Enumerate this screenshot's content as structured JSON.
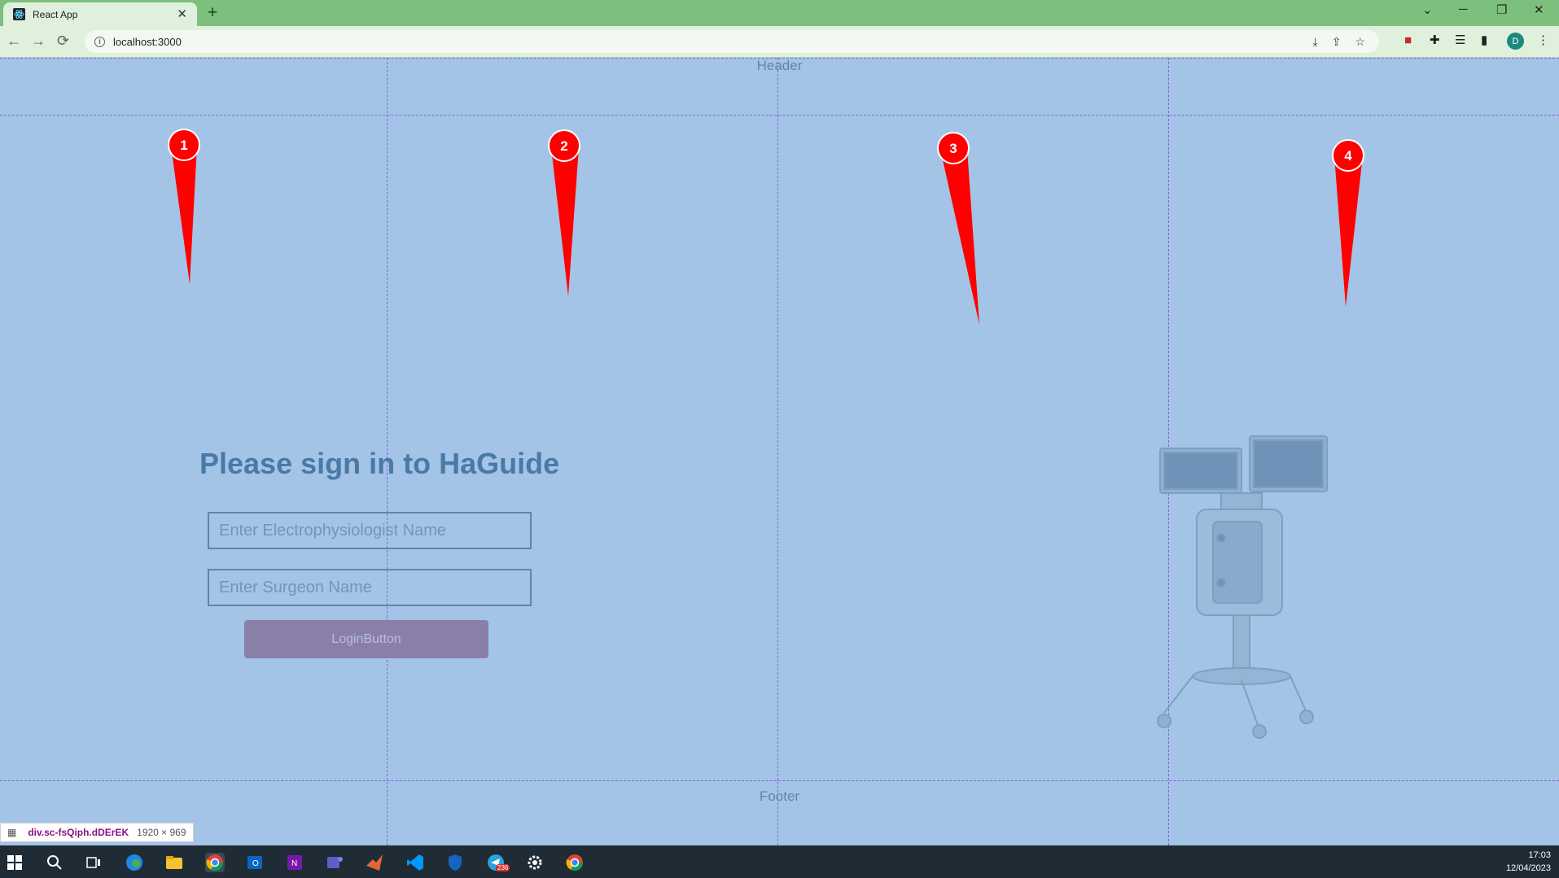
{
  "browser": {
    "tab_title": "React App",
    "tab_close": "✕",
    "new_tab": "+",
    "url": "localhost:3000",
    "profile_initial": "D",
    "window_controls": [
      "⌄",
      "─",
      "❐",
      "✕"
    ]
  },
  "page": {
    "header_label": "Header",
    "footer_label": "Footer",
    "markers": [
      "1",
      "2",
      "3",
      "4"
    ],
    "title": "Please sign in to HaGuide",
    "ep_placeholder": "Enter Electrophysiologist Name",
    "surgeon_placeholder": "Enter Surgeon Name",
    "login_label": "LoginButton"
  },
  "devtools_tooltip": {
    "selector": "div.sc-fsQiph.dDErEK",
    "dimensions": "1920 × 969"
  },
  "taskbar": {
    "time": "17:03",
    "date": "12/04/2023",
    "apps": [
      "start-icon",
      "search-icon",
      "task-view-icon",
      "edge-icon",
      "file-explorer-icon",
      "chrome-icon",
      "outlook-icon",
      "onenote-icon",
      "teams-icon",
      "matlab-icon",
      "vscode-icon",
      "security-icon",
      "telegram-icon",
      "settings-icon",
      "chrome-alt-icon"
    ],
    "telegram_badge": "236"
  },
  "colors": {
    "page_bg": "#a3c4e6",
    "marker": "#ff0000",
    "grid": "#8a63d9",
    "button": "#8a7fa8"
  }
}
